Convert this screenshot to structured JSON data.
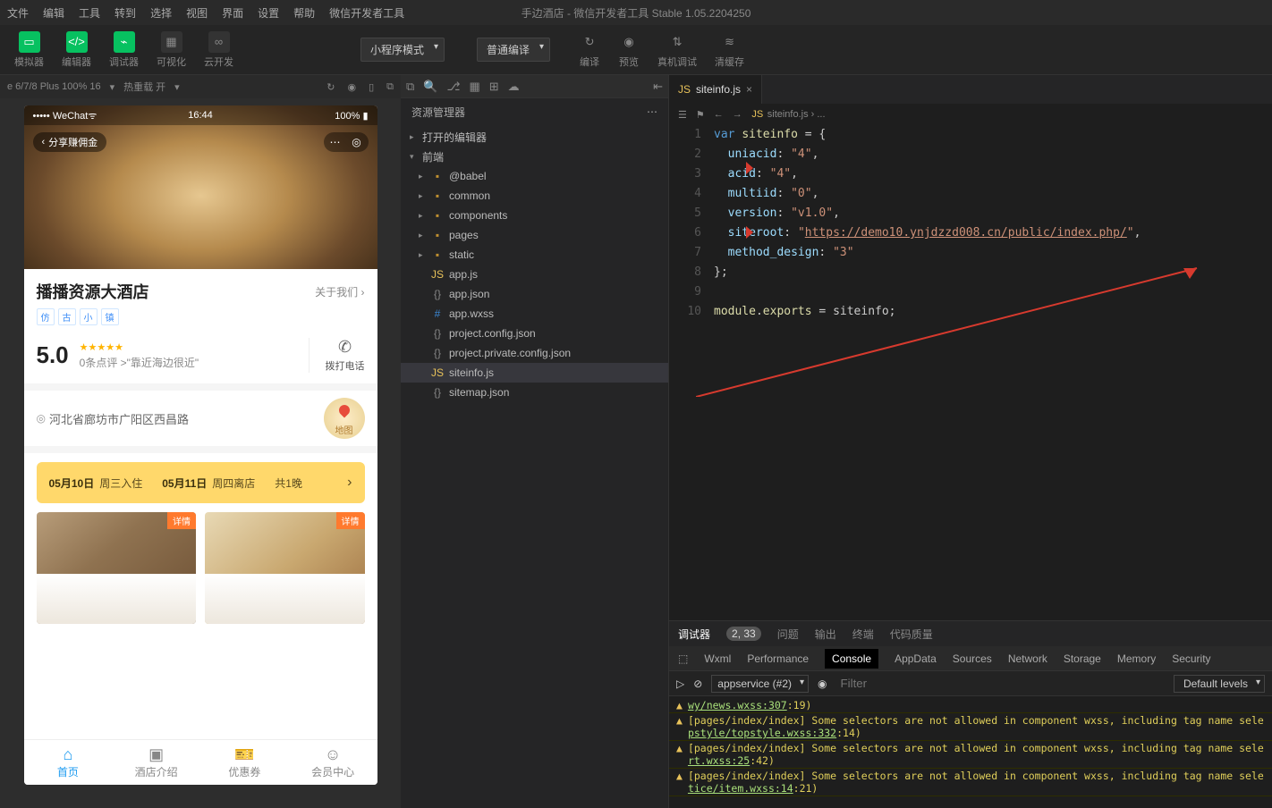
{
  "menubar": [
    "文件",
    "编辑",
    "工具",
    "转到",
    "选择",
    "视图",
    "界面",
    "设置",
    "帮助",
    "微信开发者工具"
  ],
  "titlebar": "手边酒店 - 微信开发者工具 Stable 1.05.2204250",
  "toolbar": {
    "sim": "模拟器",
    "edit": "编辑器",
    "dbg": "调试器",
    "vis": "可视化",
    "cloud": "云开发",
    "mode": "小程序模式",
    "compileOpt": "普通编译",
    "compile": "编译",
    "preview": "预览",
    "realdbg": "真机调试",
    "clear": "清缓存"
  },
  "sim": {
    "device": "e 6/7/8 Plus 100% 16",
    "hot": "热重载 开",
    "wechat": "WeChat",
    "time": "16:44",
    "batt": "100%",
    "share": "分享赚佣金",
    "hotelName": "播播资源大酒店",
    "about": "关于我们",
    "tags": [
      "仿",
      "古",
      "小",
      "镇"
    ],
    "score": "5.0",
    "ratingText": "0条点评 >\"靠近海边很近\"",
    "call": "拨打电话",
    "address": "河北省廊坊市广阳区西昌路",
    "maplbl": "地图",
    "d1": "05月10日",
    "d1s": "周三入住",
    "d2": "05月11日",
    "d2s": "周四离店",
    "nights": "共1晚",
    "roomBadge": "详情",
    "tabs": [
      "首页",
      "酒店介绍",
      "优惠券",
      "会员中心"
    ]
  },
  "explorer": {
    "title": "资源管理器",
    "openEditors": "打开的编辑器",
    "project": "前端",
    "folders": [
      "@babel",
      "common",
      "components",
      "pages",
      "static"
    ],
    "files": [
      {
        "n": "app.js",
        "t": "js"
      },
      {
        "n": "app.json",
        "t": "json"
      },
      {
        "n": "app.wxss",
        "t": "css"
      },
      {
        "n": "project.config.json",
        "t": "json"
      },
      {
        "n": "project.private.config.json",
        "t": "json"
      },
      {
        "n": "siteinfo.js",
        "t": "js",
        "sel": true
      },
      {
        "n": "sitemap.json",
        "t": "json"
      }
    ]
  },
  "editor": {
    "tab": "siteinfo.js",
    "breadcrumb": "siteinfo.js › ...",
    "lines": [
      {
        "n": 1,
        "html": "<span class='kw'>var</span> <span class='var'>siteinfo</span> = {"
      },
      {
        "n": 2,
        "html": "&nbsp;&nbsp;<span class='prop'>uniacid</span>: <span class='str'>\"4\"</span>,"
      },
      {
        "n": 3,
        "html": "&nbsp;&nbsp;<span class='prop'>acid</span>: <span class='str'>\"4\"</span>,"
      },
      {
        "n": 4,
        "html": "&nbsp;&nbsp;<span class='prop'>multiid</span>: <span class='str'>\"0\"</span>,"
      },
      {
        "n": 5,
        "html": "&nbsp;&nbsp;<span class='prop'>version</span>: <span class='str'>\"v1.0\"</span>,"
      },
      {
        "n": 6,
        "html": "&nbsp;&nbsp;<span class='prop'>siteroot</span>: <span class='str'>\"<span class='url'>https://demo10.ynjdzzd008.cn/public/index.php/</span>\"</span>,"
      },
      {
        "n": 7,
        "html": "&nbsp;&nbsp;<span class='prop'>method_design</span>: <span class='str'>\"3\"</span>"
      },
      {
        "n": 8,
        "html": "};"
      },
      {
        "n": 9,
        "html": ""
      },
      {
        "n": 10,
        "html": "<span class='var'>module</span>.<span class='var'>exports</span> = siteinfo;"
      }
    ]
  },
  "debug": {
    "tabs": [
      "调试器",
      "2, 33",
      "问题",
      "输出",
      "终端",
      "代码质量"
    ],
    "bar": [
      "Wxml",
      "Performance",
      "Console",
      "AppData",
      "Sources",
      "Network",
      "Storage",
      "Memory",
      "Security"
    ],
    "scope": "appservice (#2)",
    "filter": "Filter",
    "levels": "Default levels",
    "msgs": [
      {
        "pre": "",
        "link": "wy/news.wxss:307",
        "suf": ":19)"
      },
      {
        "pre": "[pages/index/index] Some selectors are not allowed in component wxss, including tag name sele",
        "link": "pstyle/topstyle.wxss:332",
        "suf": ":14)"
      },
      {
        "pre": "[pages/index/index] Some selectors are not allowed in component wxss, including tag name sele",
        "link": "rt.wxss:25",
        "suf": ":42)"
      },
      {
        "pre": "[pages/index/index] Some selectors are not allowed in component wxss, including tag name sele",
        "link": "tice/item.wxss:14",
        "suf": ":21)"
      }
    ]
  }
}
